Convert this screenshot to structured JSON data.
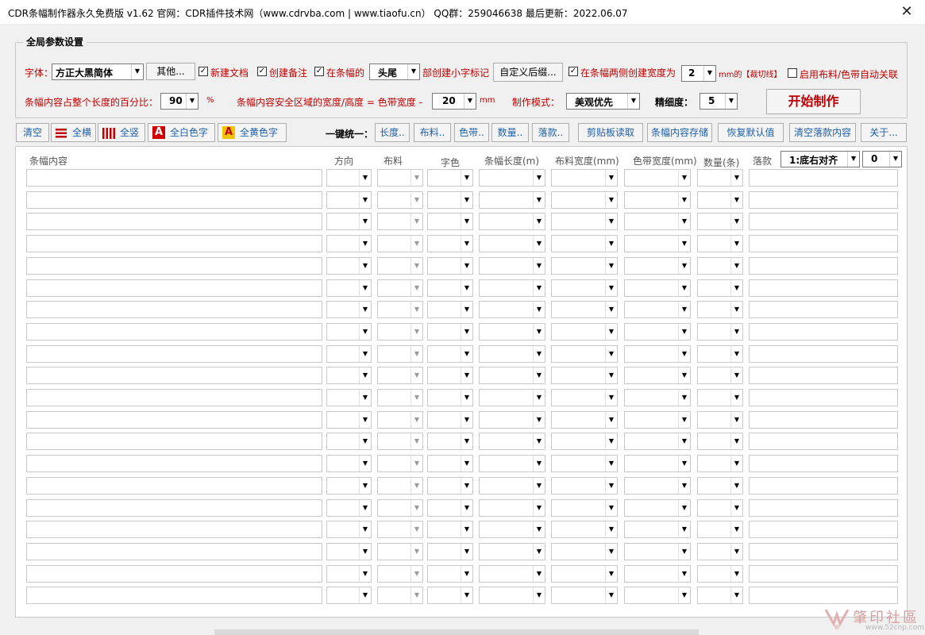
{
  "window": {
    "title": "CDR条幅制作器永久免费版 v1.62    官网：CDR插件技术网（www.cdrvba.com | www.tiaofu.cn）   QQ群：259046638     最后更新：2022.06.07",
    "close": "✕"
  },
  "settings": {
    "legend": "全局参数设置",
    "font_label": "字体：",
    "font_value": "方正大黑简体",
    "other_button": "其他...",
    "new_doc": {
      "label": "新建文档",
      "checked": true
    },
    "create_note": {
      "label": "创建备注",
      "checked": true
    },
    "at_banner": {
      "label": "在条幅的",
      "checked": true
    },
    "position_value": "头尾",
    "small_mark_label": "部创建小字标记",
    "custom_suffix_button": "自定义后缀...",
    "both_sides": {
      "label": "在条幅两侧创建宽度为",
      "checked": true
    },
    "cut_width_value": "2",
    "cut_line_label": "mm的【裁切线】",
    "auto_link": {
      "label": "启用布料/色带自动关联",
      "checked": false
    },
    "percent_label": "条幅内容占整个长度的百分比：",
    "percent_value": "90",
    "percent_unit": "%",
    "safe_area_label": "条幅内容安全区域的宽度/高度 = 色带宽度 -",
    "safe_area_value": "20",
    "safe_area_unit": "mm",
    "mode_label": "制作模式：",
    "mode_value": "美观优先",
    "fineness_label": "精细度：",
    "fineness_value": "5",
    "start_button": "开始制作"
  },
  "toolbar": {
    "clear": "清空",
    "all_horizontal": "全横",
    "all_vertical": "全竖",
    "all_white": "全白色字",
    "all_yellow": "全黄色字",
    "unify_label": "一键统一：",
    "length": "长度..",
    "cloth": "布料..",
    "ribbon": "色带..",
    "quantity": "数量..",
    "signature": "落款..",
    "clipboard_read": "剪贴板读取",
    "save_content": "条幅内容存储",
    "restore_default": "恢复默认值",
    "clear_signature": "清空落款内容",
    "about": "关于..."
  },
  "grid": {
    "headers": {
      "content": "条幅内容",
      "direction": "方向",
      "cloth": "布料",
      "text_color": "字色",
      "length": "条幅长度(m)",
      "cloth_width": "布料宽度(mm)",
      "ribbon_width": "色带宽度(mm)",
      "quantity": "数量(条)",
      "signature": "落款"
    },
    "signature_align_value": "1:底右对齐",
    "signature_offset_value": "0",
    "row_count": 20
  },
  "watermark": {
    "name": "肇印社區",
    "url": "www.52cnp.com"
  },
  "colors": {
    "accent_red": "#c00000",
    "toolbar_text": "#1f5fa8"
  }
}
